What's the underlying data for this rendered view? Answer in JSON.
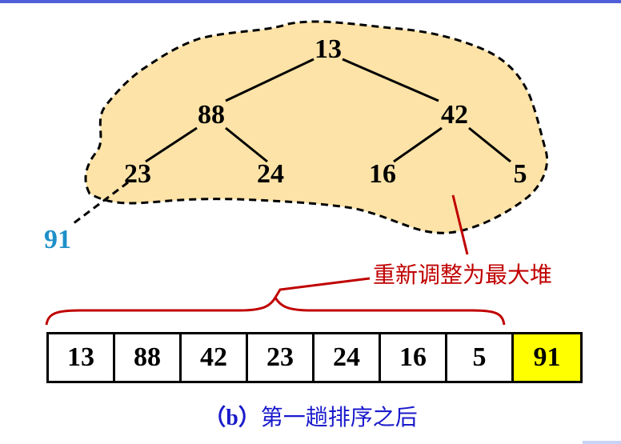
{
  "heap": {
    "nodes": [
      {
        "id": "n13",
        "label": "13"
      },
      {
        "id": "n88",
        "label": "88"
      },
      {
        "id": "n42",
        "label": "42"
      },
      {
        "id": "n23",
        "label": "23"
      },
      {
        "id": "n24",
        "label": "24"
      },
      {
        "id": "n16",
        "label": "16"
      },
      {
        "id": "n5",
        "label": "5"
      }
    ],
    "edges": [
      [
        "n13",
        "n88"
      ],
      [
        "n13",
        "n42"
      ],
      [
        "n88",
        "n23"
      ],
      [
        "n88",
        "n24"
      ],
      [
        "n42",
        "n16"
      ],
      [
        "n42",
        "n5"
      ]
    ],
    "removed_node": "91",
    "region_fill": "#fde3a7",
    "removed_color": "#1e90c8"
  },
  "annotation": {
    "text": "重新调整为最大堆",
    "color": "#c00000"
  },
  "array": {
    "cells": [
      "13",
      "88",
      "42",
      "23",
      "24",
      "16",
      "5",
      "91"
    ],
    "sorted_index": 7,
    "sorted_color": "#ffff00"
  },
  "caption": {
    "prefix": "（b）",
    "text": "第一趟排序之后",
    "color": "#1a1acc"
  }
}
